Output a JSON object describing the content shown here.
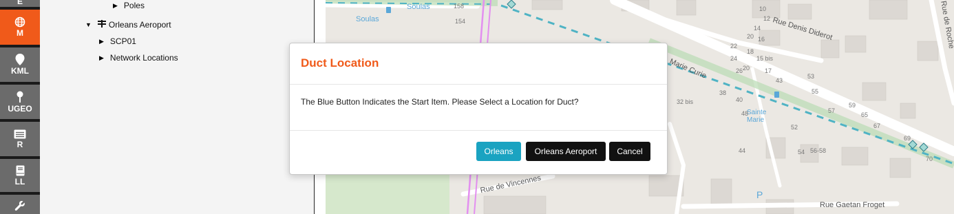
{
  "rail": {
    "items": [
      {
        "label": "E",
        "icon": "e-icon",
        "active": false
      },
      {
        "label": "M",
        "icon": "globe-icon",
        "active": true
      },
      {
        "label": "KML",
        "icon": "map-pin-icon",
        "active": false
      },
      {
        "label": "UGEO",
        "icon": "pin-icon",
        "active": false
      },
      {
        "label": "R",
        "icon": "list-card-icon",
        "active": false
      },
      {
        "label": "LL",
        "icon": "book-icon",
        "active": false
      },
      {
        "label": "",
        "icon": "wrench-icon",
        "active": false
      }
    ]
  },
  "tree": {
    "items": [
      {
        "label": "Poles",
        "expanded": false
      },
      {
        "label": "Orleans Aeroport",
        "expanded": true,
        "icon": "network-icon"
      },
      {
        "label": "SCP01",
        "expanded": false
      },
      {
        "label": "Network Locations",
        "expanded": false
      }
    ]
  },
  "map": {
    "streets": [
      "Rue Denis Diderot",
      "Marie Curie",
      "Rue de Vincennes",
      "Rue Gaetan Froget",
      "Rue de Roche"
    ],
    "places": [
      "Soulas",
      "Soulas",
      "Sainte Marie"
    ],
    "house_numbers": [
      "158",
      "154",
      "10",
      "12",
      "14",
      "16",
      "20",
      "22",
      "24",
      "26",
      "18",
      "20",
      "15 bis",
      "17",
      "38",
      "40",
      "43",
      "53",
      "55",
      "57",
      "59",
      "65",
      "67",
      "69",
      "32 bis",
      "48",
      "52",
      "54",
      "56-58",
      "44",
      "70",
      "P"
    ],
    "colors": {
      "route": "#a2d9d5",
      "road_dash": "#4fb3c4",
      "duct": "#e38ff0"
    }
  },
  "dialog": {
    "title": "Duct Location",
    "message": "The Blue Button Indicates the Start Item. Please Select a Location for Duct?",
    "buttons": {
      "start": "Orleans",
      "alternate": "Orleans Aeroport",
      "cancel": "Cancel"
    },
    "colors": {
      "title": "#f05a1a",
      "start_button": "#1aa3c1",
      "dark_button": "#111111"
    }
  }
}
